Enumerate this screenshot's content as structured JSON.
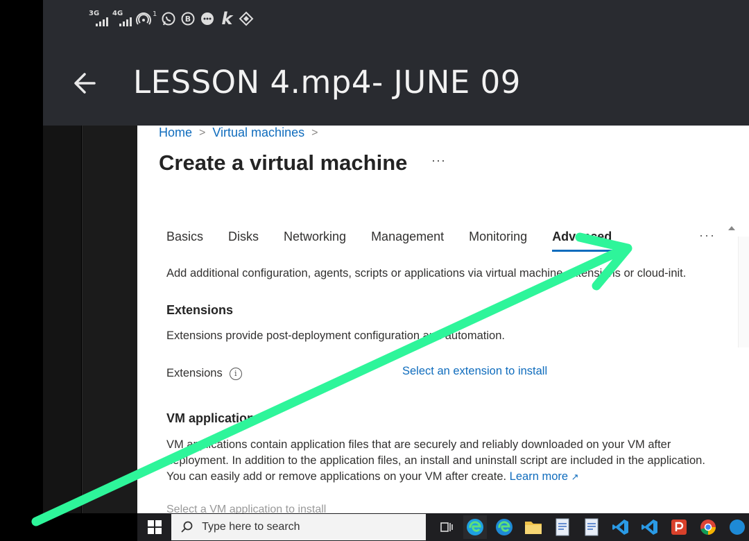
{
  "status_bar": {
    "net1": "3G",
    "net2": "4G",
    "hotspot_count": "1",
    "icons": [
      "signal-icon",
      "hotspot-icon",
      "whatsapp-icon",
      "b-icon",
      "chat-icon",
      "k-icon",
      "tag-icon"
    ],
    "k_glyph": "k",
    "b_glyph": "B"
  },
  "video": {
    "title": "LESSON 4.mp4- JUNE 09",
    "back_icon": "arrow-left-icon"
  },
  "portal": {
    "breadcrumb": [
      "Home",
      "Virtual machines"
    ],
    "breadcrumb_sep": ">",
    "page_title": "Create a virtual machine",
    "more": "···",
    "tabs": [
      "Basics",
      "Disks",
      "Networking",
      "Management",
      "Monitoring",
      "Advanced"
    ],
    "active_tab": "Advanced",
    "tabs_more": "···",
    "description": "Add additional configuration, agents, scripts or applications via virtual machine extensions or cloud-init.",
    "extensions": {
      "heading": "Extensions",
      "description": "Extensions provide post-deployment configuration and automation.",
      "label": "Extensions",
      "info": "i",
      "link": "Select an extension to install"
    },
    "vm_applications": {
      "heading": "VM applications",
      "description": "VM applications contain application files that are securely and reliably downloaded on your VM after deployment. In addition to the application files, an install and uninstall script are included in the application. You can easily add or remove applications on your VM after create.",
      "learn_more": "Learn more",
      "next_line": "Select a VM application to install"
    }
  },
  "taskbar": {
    "search_placeholder": "Type here to search",
    "apps": [
      "task-view-icon",
      "edge-icon",
      "edge-icon",
      "file-explorer-icon",
      "notepad-icon",
      "notepad-icon",
      "vscode-icon",
      "vscode-icon",
      "powerpoint-icon",
      "chrome-icon",
      "edge-icon"
    ]
  },
  "colors": {
    "arrow": "#2ef59a",
    "link": "#0f6cbd",
    "title_bar": "#292b30"
  }
}
